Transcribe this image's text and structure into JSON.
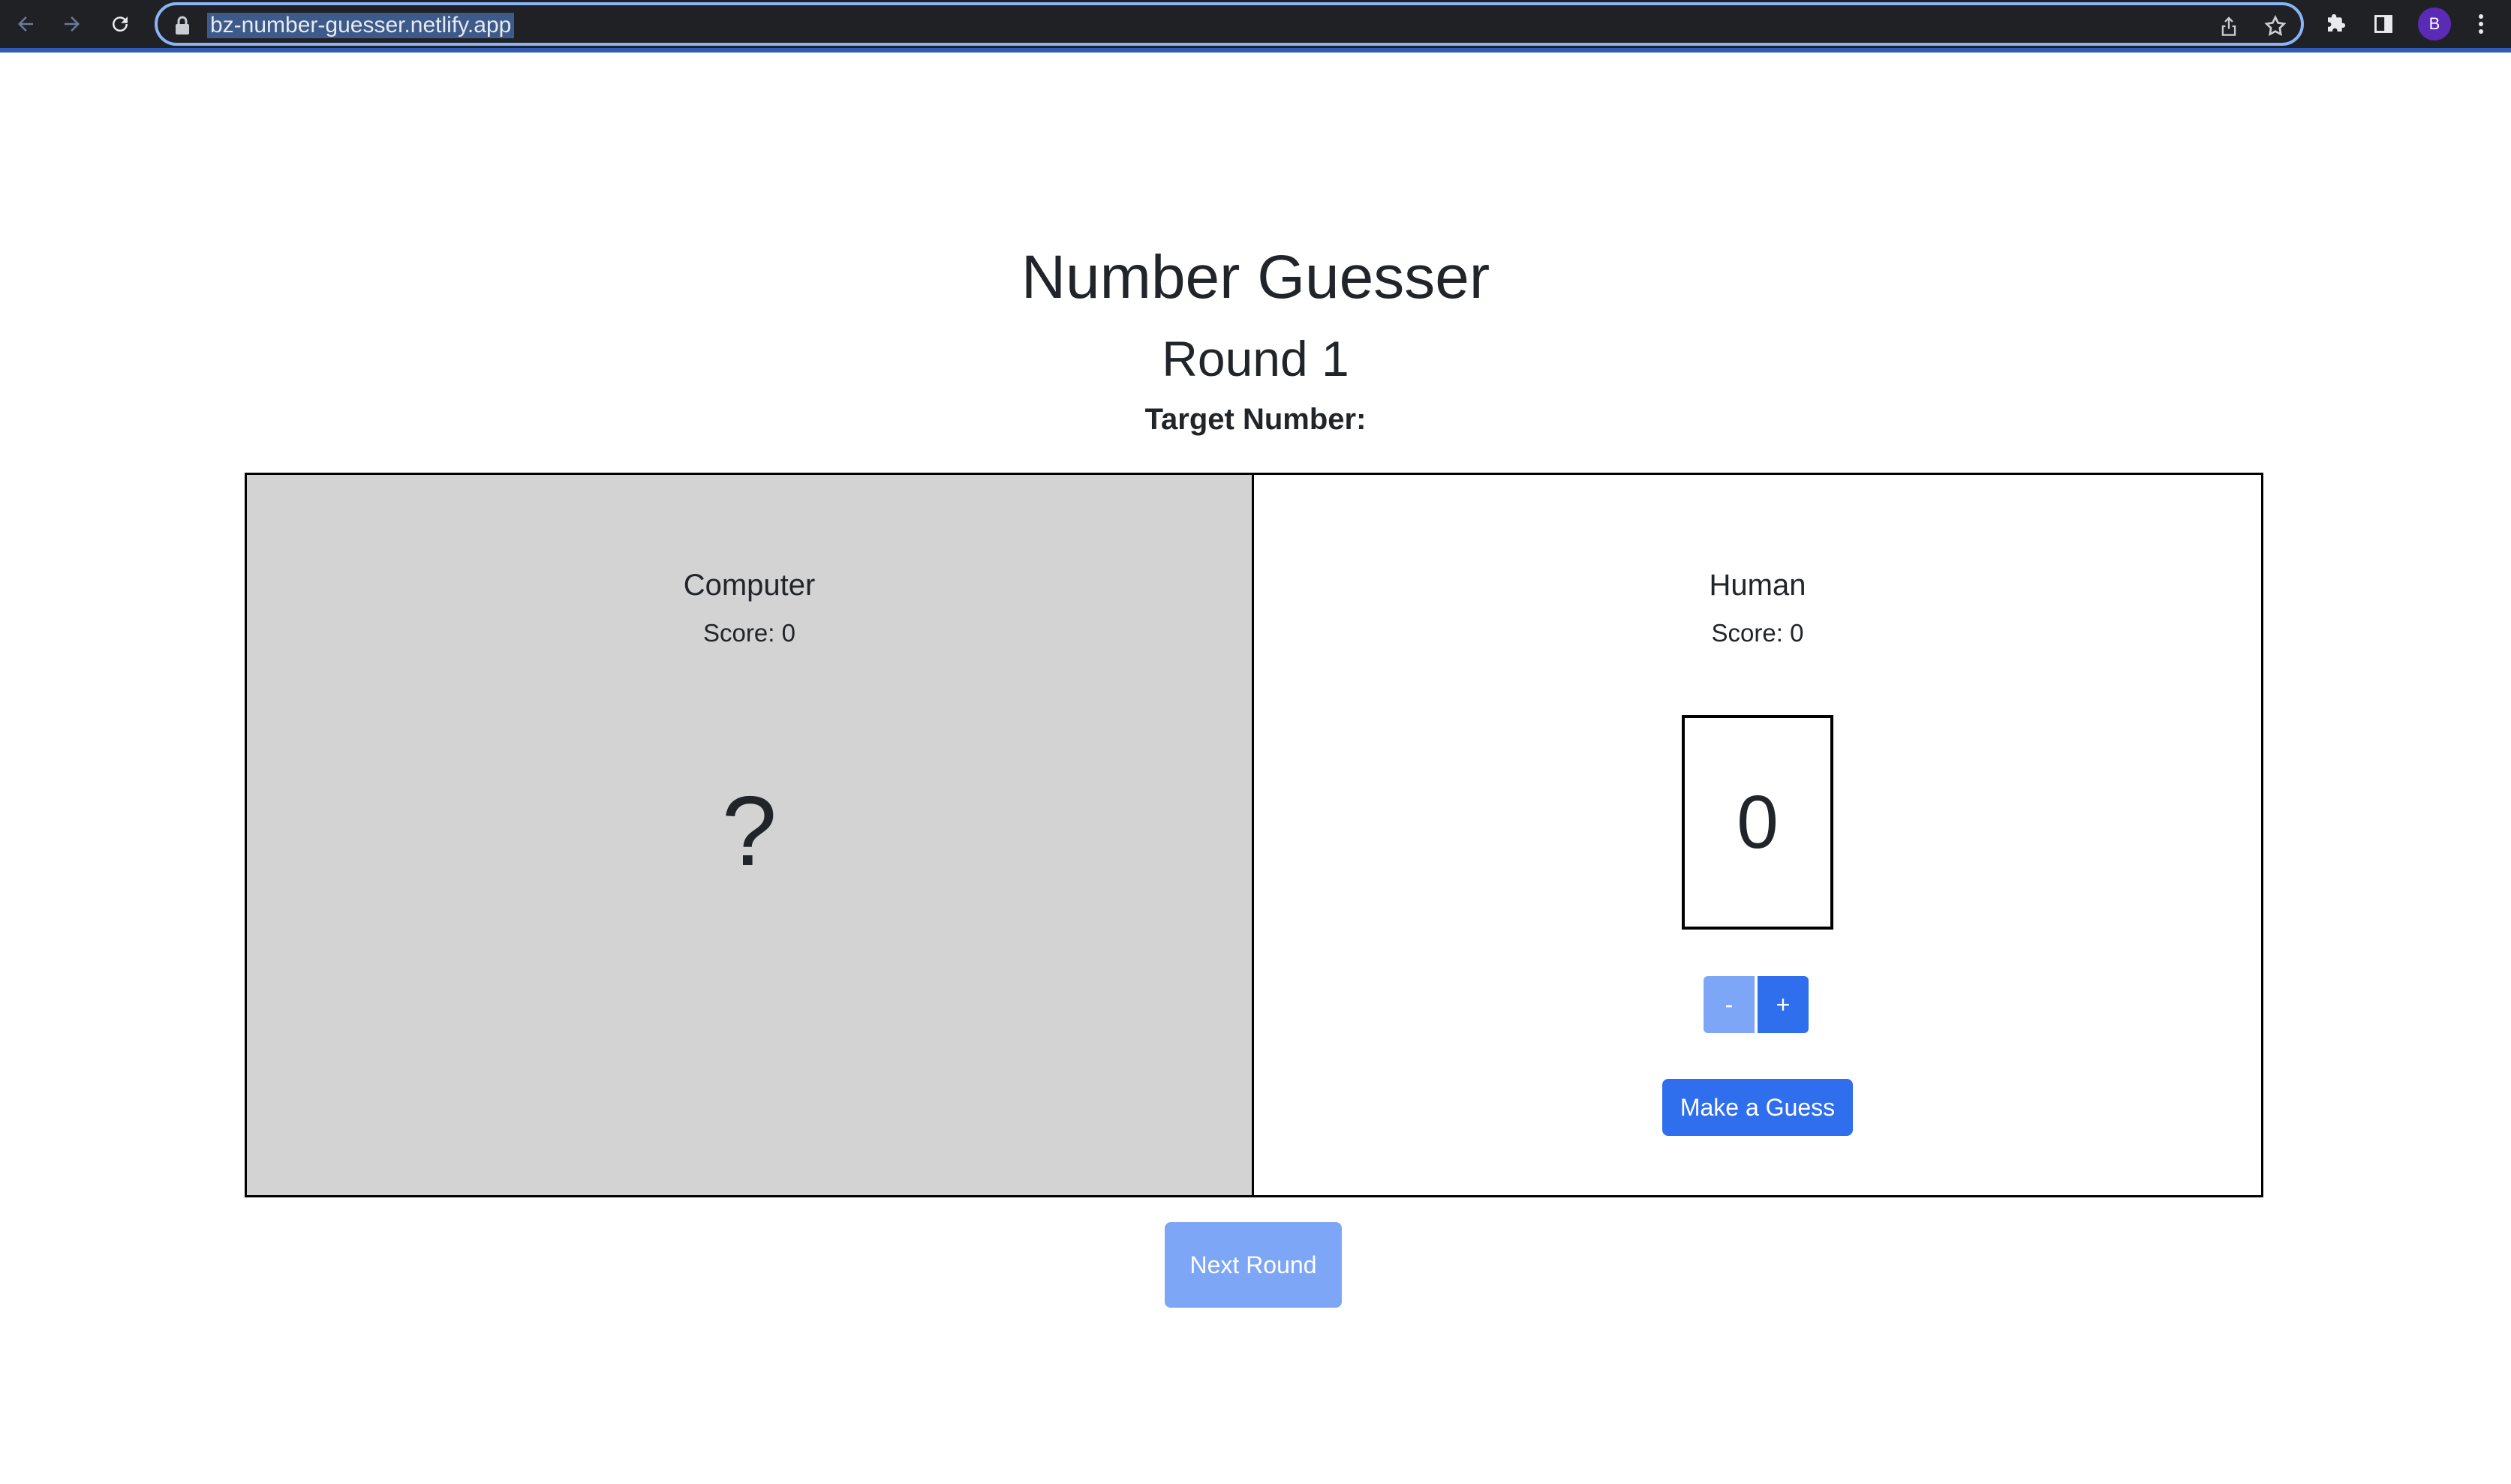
{
  "browser": {
    "url": "bz-number-guesser.netlify.app",
    "profile_initial": "B",
    "icons": [
      "back-icon",
      "forward-icon",
      "reload-icon",
      "lock-icon",
      "share-icon",
      "bookmark-star-icon",
      "extensions-icon",
      "side-panel-icon",
      "menu-dots-icon"
    ]
  },
  "game": {
    "title": "Number Guesser",
    "round": "Round 1",
    "target_label": "Target Number:"
  },
  "computer": {
    "name": "Computer",
    "score": "Score: 0",
    "guess": "?"
  },
  "human": {
    "name": "Human",
    "score": "Score: 0",
    "guess": "0",
    "minus_label": "-",
    "plus_label": "+",
    "submit_label": "Make a Guess"
  },
  "next_round_label": "Next Round",
  "colors": {
    "primary": "#2f6fed",
    "primary_disabled": "#7ea6f7",
    "computer_panel": "#d3d3d3"
  }
}
